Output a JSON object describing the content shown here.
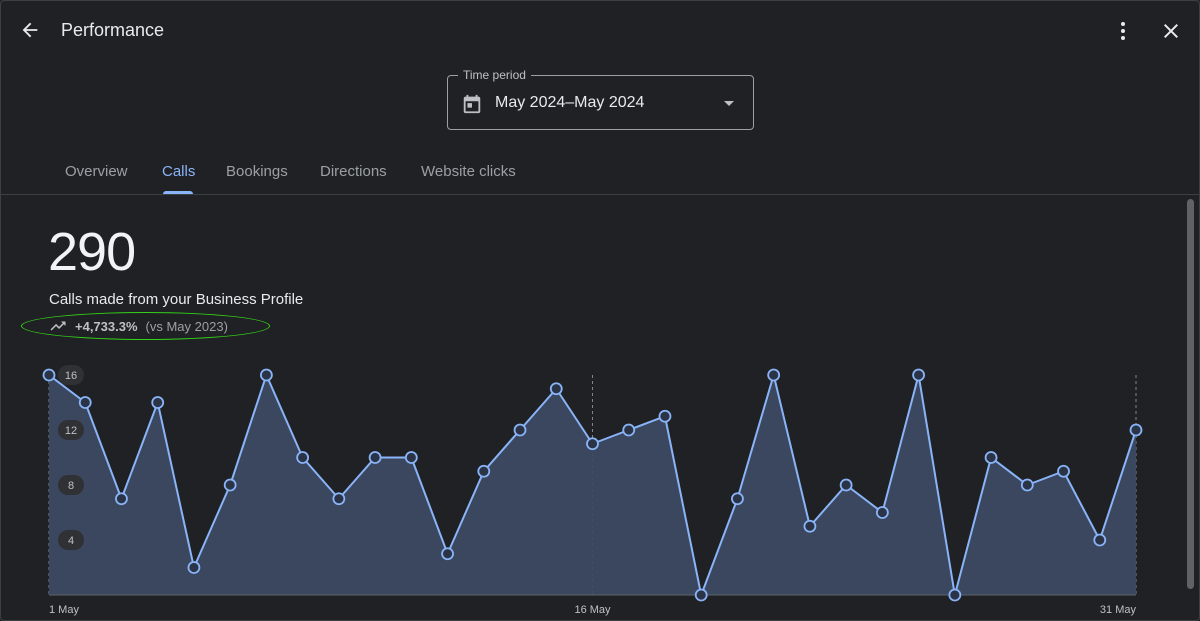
{
  "header": {
    "title": "Performance",
    "back_icon": "arrow-back-icon",
    "menu_icon": "more-vert-icon",
    "close_icon": "close-icon"
  },
  "time_period": {
    "label": "Time period",
    "value": "May 2024–May 2024",
    "icon": "calendar-icon"
  },
  "tabs": [
    {
      "label": "Overview",
      "active": false
    },
    {
      "label": "Calls",
      "active": true
    },
    {
      "label": "Bookings",
      "active": false
    },
    {
      "label": "Directions",
      "active": false
    },
    {
      "label": "Website clicks",
      "active": false
    }
  ],
  "summary": {
    "metric": "290",
    "label": "Calls made from your Business Profile",
    "trend_icon": "trending-up-icon",
    "change": "+4,733.3%",
    "comparison": "(vs May 2023)"
  },
  "colors": {
    "accent": "#8ab4f8",
    "area_fill": "#3c4a63",
    "highlight": "#34d11a"
  },
  "chart_data": {
    "type": "area",
    "x_labels": [
      "1 May",
      "16 May",
      "31 May"
    ],
    "x": [
      "1 May",
      "2 May",
      "3 May",
      "4 May",
      "5 May",
      "6 May",
      "7 May",
      "8 May",
      "9 May",
      "10 May",
      "11 May",
      "12 May",
      "13 May",
      "14 May",
      "15 May",
      "16 May",
      "17 May",
      "18 May",
      "19 May",
      "20 May",
      "21 May",
      "22 May",
      "23 May",
      "24 May",
      "25 May",
      "26 May",
      "27 May",
      "28 May",
      "29 May",
      "30 May",
      "31 May"
    ],
    "values": [
      16,
      14,
      7,
      14,
      2,
      8,
      16,
      10,
      7,
      10,
      10,
      3,
      9,
      12,
      15,
      11,
      12,
      13,
      0,
      7,
      16,
      5,
      8,
      6,
      16,
      0,
      10,
      8,
      9,
      4,
      12
    ],
    "y_ticks": [
      4,
      8,
      12,
      16
    ],
    "ylim": [
      0,
      16
    ],
    "grid": false
  }
}
